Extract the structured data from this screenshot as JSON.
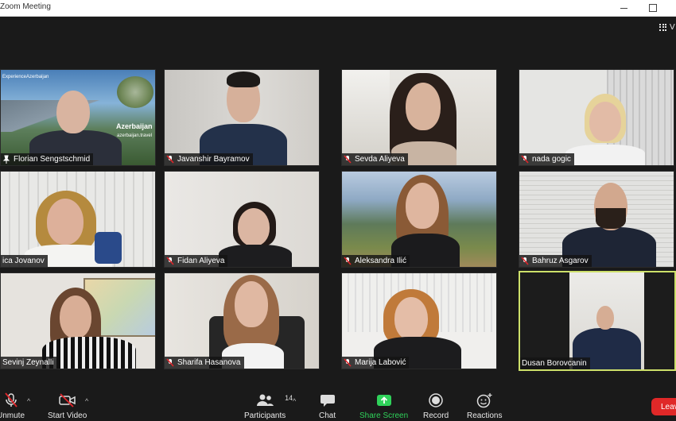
{
  "window": {
    "title": "Zoom Meeting"
  },
  "view": {
    "label": "V"
  },
  "participants": [
    {
      "name": "Florian Sengstschmid",
      "muted": false,
      "bg": "scenery",
      "active": false
    },
    {
      "name": "Javanshir Bayramov",
      "muted": true,
      "bg": "wall",
      "active": false
    },
    {
      "name": "Sevda Aliyeva",
      "muted": true,
      "bg": "office",
      "active": false
    },
    {
      "name": "nada gogic",
      "muted": true,
      "bg": "blinds",
      "active": false
    },
    {
      "name": "ica Jovanov",
      "muted": false,
      "bg": "blinds",
      "active": false
    },
    {
      "name": "Fidan Aliyeva",
      "muted": true,
      "bg": "wall",
      "active": false
    },
    {
      "name": "Aleksandra Ilić",
      "muted": true,
      "bg": "lake",
      "active": false
    },
    {
      "name": "Bahruz Asgarov",
      "muted": true,
      "bg": "blinds",
      "active": false
    },
    {
      "name": "Sevinj Zeynalli",
      "muted": false,
      "bg": "map",
      "active": false
    },
    {
      "name": "Sharifa Hasanova",
      "muted": true,
      "bg": "wall",
      "active": false
    },
    {
      "name": "Marija Labović",
      "muted": true,
      "bg": "office",
      "active": false
    },
    {
      "name": "Dusan Borovcanin",
      "muted": false,
      "bg": "office",
      "active": true
    }
  ],
  "banner": {
    "tag": "ExperienceAzerbaijan",
    "brand": "Azerbaijan",
    "url": "azerbaijan.travel"
  },
  "toolbar": {
    "unmute": "Unmute",
    "start_video": "Start Video",
    "participants": "Participants",
    "participant_count": "14",
    "chat": "Chat",
    "share_screen": "Share Screen",
    "record": "Record",
    "reactions": "Reactions",
    "leave": "Leave"
  },
  "colors": {
    "share_green": "#2fd25a",
    "leave_red": "#e02828",
    "active_border": "#cde06a",
    "mute_red": "#e0262b"
  }
}
